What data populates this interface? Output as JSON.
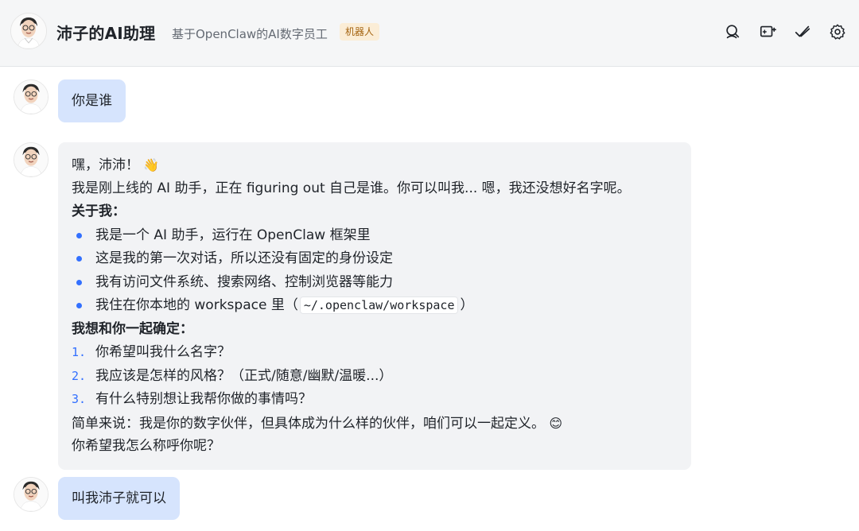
{
  "header": {
    "title": "沛子的AI助理",
    "subtitle": "基于OpenClaw的AI数字员工",
    "tag": "机器人",
    "tools": [
      "search-icon",
      "new-chat-icon",
      "check-icon",
      "settings-icon"
    ]
  },
  "messages": {
    "m1": {
      "role": "user",
      "text": "你是谁"
    },
    "m2": {
      "role": "assistant",
      "greeting": "嘿，沛沛！",
      "greeting_emoji": "👋",
      "intro": "我是刚上线的 AI 助手，正在 figuring out 自己是谁。你可以叫我... 嗯，我还没想好名字呢。",
      "about_heading": "关于我：",
      "bullets": [
        "我是一个 AI 助手，运行在 OpenClaw 框架里",
        "这是我的第一次对话，所以还没有固定的身份设定",
        "我有访问文件系统、搜索网络、控制浏览器等能力"
      ],
      "workspace_prefix": "我住在你本地的 workspace 里（",
      "workspace_path": "~/.openclaw/workspace",
      "workspace_suffix": "）",
      "confirm_heading": "我想和你一起确定：",
      "questions": [
        {
          "num": "1.",
          "text": "你希望叫我什么名字？"
        },
        {
          "num": "2.",
          "text": "我应该是怎样的风格？（正式/随意/幽默/温暖...）"
        },
        {
          "num": "3.",
          "text": "有什么特别想让我帮你做的事情吗？"
        }
      ],
      "summary": "简单来说：我是你的数字伙伴，但具体成为什么样的伙伴，咱们可以一起定义。",
      "summary_emoji": "😊",
      "closing": "你希望我怎么称呼你呢？"
    },
    "m3": {
      "role": "user",
      "text": "叫我沛子就可以"
    }
  },
  "colors": {
    "user_bubble": "#d6e4fd",
    "bot_bubble": "#f2f3f5",
    "accent": "#3370ff",
    "tag_bg": "#fbedd6",
    "tag_text": "#a4630f"
  }
}
